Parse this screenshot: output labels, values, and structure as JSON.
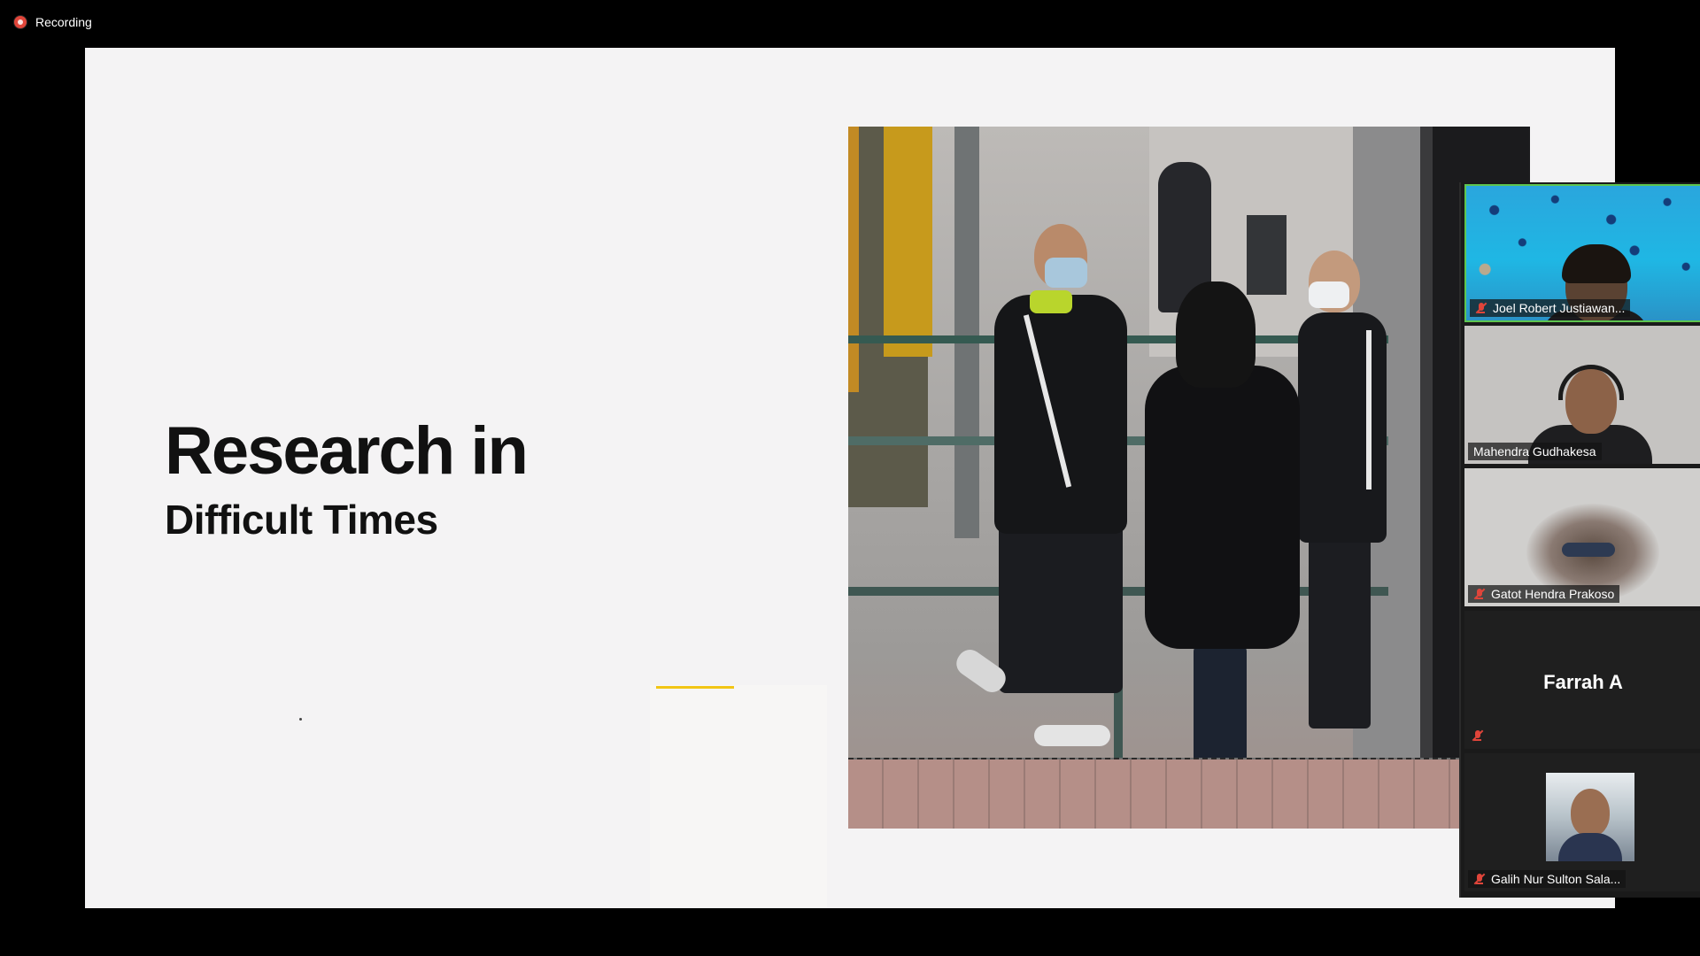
{
  "recording": {
    "label": "Recording"
  },
  "slide": {
    "title": "Research in",
    "subtitle": "Difficult Times",
    "accent_color": "#f2c515"
  },
  "participants": [
    {
      "name": "Joel Robert Justiawan...",
      "muted": true,
      "active_speaker": true
    },
    {
      "name": "Mahendra Gudhakesa",
      "muted": false
    },
    {
      "name": "Gatot Hendra Prakoso",
      "muted": true
    },
    {
      "name": "Farrah A",
      "muted": true,
      "video": false
    },
    {
      "name": "Galih Nur Sulton Sala...",
      "muted": true
    }
  ],
  "icons": {
    "recording": "record-icon",
    "muted": "mic-muted-icon"
  }
}
